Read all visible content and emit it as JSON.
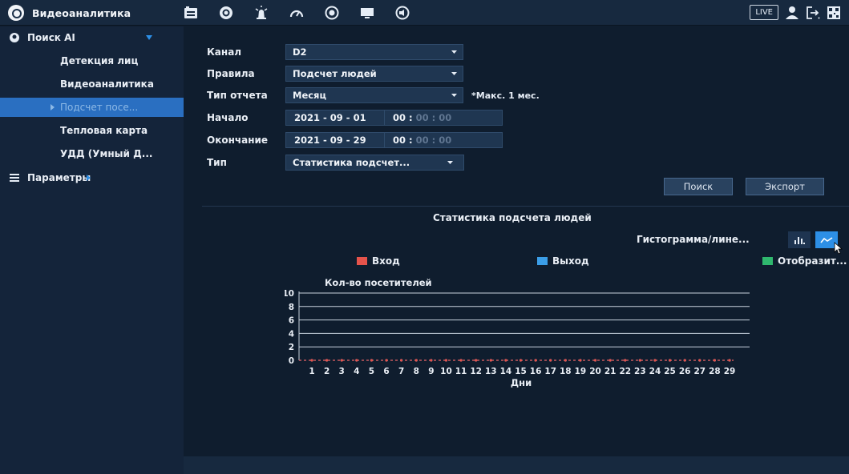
{
  "app": {
    "title": "Видеоаналитика",
    "live_label": "LIVE"
  },
  "toolbar": {
    "icons": [
      "film-icon",
      "face-icon",
      "alarm-icon",
      "gauge-icon",
      "record-icon",
      "monitor-icon",
      "audio-icon"
    ],
    "right_icons": [
      "user-icon",
      "logout-icon",
      "qr-icon"
    ]
  },
  "sidebar": {
    "search": {
      "label": "Поиск AI"
    },
    "items": [
      {
        "label": "Детекция лиц",
        "active": false
      },
      {
        "label": "Видеоаналитика",
        "active": false
      },
      {
        "label": "Подсчет посе...",
        "active": true
      },
      {
        "label": "Тепловая карта",
        "active": false
      },
      {
        "label": "УДД (Умный Д...",
        "active": false
      }
    ],
    "params": {
      "label": "Параметры"
    }
  },
  "form": {
    "channel": {
      "label": "Канал",
      "value": "D2"
    },
    "rules": {
      "label": "Правила",
      "value": "Подсчет людей"
    },
    "report_type": {
      "label": "Тип отчета",
      "value": "Месяц",
      "hint": "*Макс. 1 мес."
    },
    "start": {
      "label": "Начало",
      "date": "2021 - 09 - 01",
      "time_h": "00 :",
      "time_rest": " 00 : 00"
    },
    "end": {
      "label": "Окончание",
      "date": "2021 - 09 - 29",
      "time_h": "00 :",
      "time_rest": " 00 : 00"
    },
    "type": {
      "label": "Тип",
      "value": "Статистика подсчет..."
    }
  },
  "buttons": {
    "search": "Поиск",
    "export": "Экспорт"
  },
  "view": {
    "label": "Гистограмма/лине..."
  },
  "colors": {
    "accent": "#2d8fe6",
    "active": "#2a6fc1",
    "in": "#e5534b",
    "out": "#3b9ee8",
    "show": "#2fb86e"
  },
  "chart_data": {
    "type": "line",
    "title": "Статистика подсчета людей",
    "ylabel": "Кол-во посетителей",
    "xlabel": "Дни",
    "ylim": [
      0,
      10
    ],
    "y_ticks": [
      0,
      2,
      4,
      6,
      8,
      10
    ],
    "x": [
      1,
      2,
      3,
      4,
      5,
      6,
      7,
      8,
      9,
      10,
      11,
      12,
      13,
      14,
      15,
      16,
      17,
      18,
      19,
      20,
      21,
      22,
      23,
      24,
      25,
      26,
      27,
      28,
      29
    ],
    "series": [
      {
        "name": "Вход",
        "color": "#e5534b",
        "values": [
          0,
          0,
          0,
          0,
          0,
          0,
          0,
          0,
          0,
          0,
          0,
          0,
          0,
          0,
          0,
          0,
          0,
          0,
          0,
          0,
          0,
          0,
          0,
          0,
          0,
          0,
          0,
          0,
          0
        ]
      },
      {
        "name": "Выход",
        "color": "#3b9ee8",
        "values": [
          0,
          0,
          0,
          0,
          0,
          0,
          0,
          0,
          0,
          0,
          0,
          0,
          0,
          0,
          0,
          0,
          0,
          0,
          0,
          0,
          0,
          0,
          0,
          0,
          0,
          0,
          0,
          0,
          0
        ]
      },
      {
        "name": "Отобразит...",
        "color": "#2fb86e",
        "values": []
      }
    ],
    "grid": true
  }
}
